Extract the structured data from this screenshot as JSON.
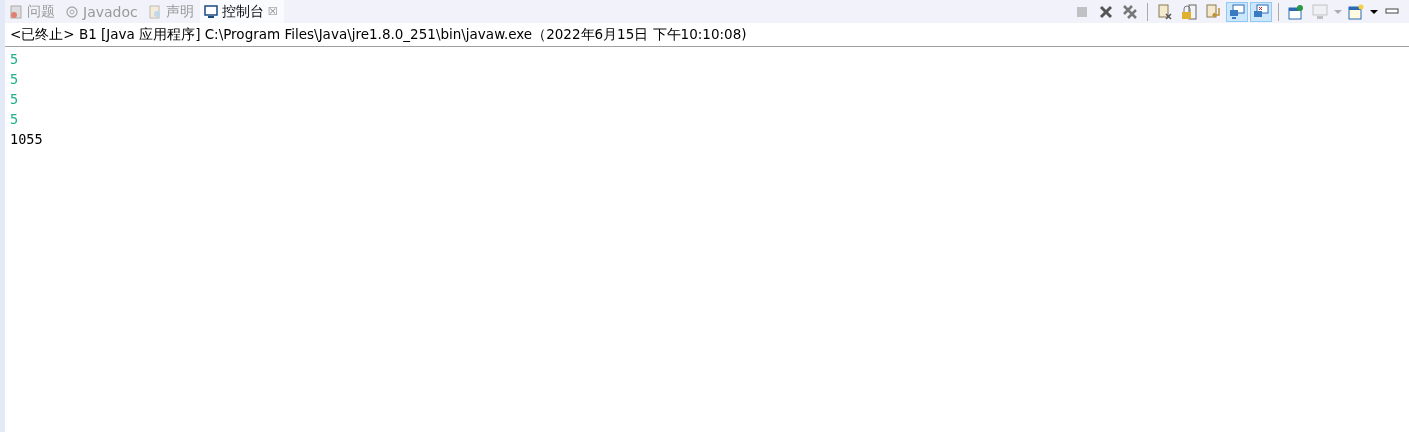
{
  "tabs": [
    {
      "kind": "problems",
      "label": "问题",
      "selected": false
    },
    {
      "kind": "javadoc",
      "label": "Javadoc",
      "selected": false
    },
    {
      "kind": "declaration",
      "label": "声明",
      "selected": false
    },
    {
      "kind": "console",
      "label": "控制台",
      "selected": true,
      "close": "☒"
    }
  ],
  "toolbar": [
    {
      "kind": "terminate",
      "disabled": true,
      "pressed": false
    },
    {
      "kind": "remove",
      "disabled": false,
      "pressed": false
    },
    {
      "kind": "remove-all",
      "disabled": false,
      "pressed": false
    },
    {
      "kind": "separator"
    },
    {
      "kind": "clear",
      "disabled": false,
      "pressed": false
    },
    {
      "kind": "lock",
      "disabled": false,
      "pressed": false
    },
    {
      "kind": "wrap",
      "disabled": false,
      "pressed": false
    },
    {
      "kind": "monitor-out",
      "disabled": false,
      "pressed": true
    },
    {
      "kind": "monitor-err",
      "disabled": false,
      "pressed": true
    },
    {
      "kind": "separator"
    },
    {
      "kind": "pin",
      "disabled": false,
      "pressed": false
    },
    {
      "kind": "display",
      "disabled": true,
      "pressed": false
    },
    {
      "kind": "dropdown",
      "disabled": true,
      "pressed": false
    },
    {
      "kind": "new-console",
      "disabled": false,
      "pressed": false
    },
    {
      "kind": "dropdown",
      "disabled": false,
      "pressed": false
    },
    {
      "kind": "minimize",
      "disabled": false,
      "pressed": false
    }
  ],
  "console": {
    "header": "<已终止> B1 [Java 应用程序] C:\\Program Files\\Java\\jre1.8.0_251\\bin\\javaw.exe（2022年6月15日 下午10:10:08)",
    "lines": [
      {
        "text": "5",
        "color": "#1fb08c"
      },
      {
        "text": "5",
        "color": "#1fb08c"
      },
      {
        "text": "5",
        "color": "#1fb08c"
      },
      {
        "text": "5",
        "color": "#1fb08c"
      },
      {
        "text": "1055",
        "color": "#000000"
      }
    ]
  }
}
